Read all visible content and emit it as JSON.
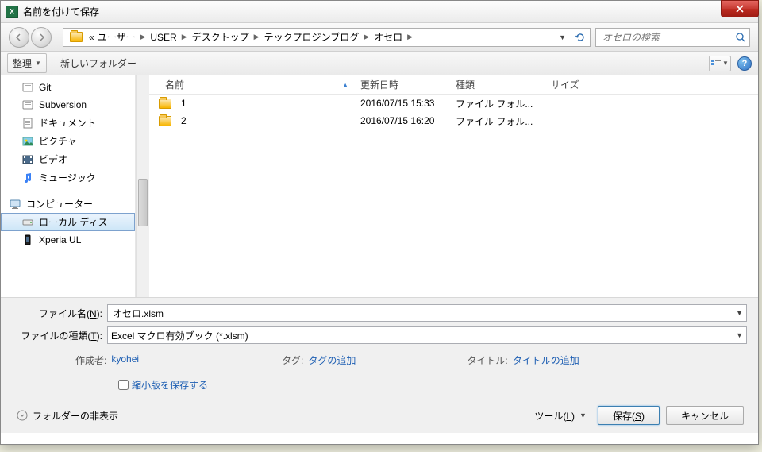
{
  "title": "名前を付けて保存",
  "breadcrumb": {
    "prefix": "«",
    "items": [
      "ユーザー",
      "USER",
      "デスクトップ",
      "テックプロジンブログ",
      "オセロ"
    ]
  },
  "search": {
    "placeholder": "オセロの検索"
  },
  "toolbar": {
    "organize": "整理",
    "newfolder": "新しいフォルダー"
  },
  "sidebar": {
    "items": [
      {
        "label": "Git"
      },
      {
        "label": "Subversion"
      },
      {
        "label": "ドキュメント"
      },
      {
        "label": "ピクチャ"
      },
      {
        "label": "ビデオ"
      },
      {
        "label": "ミュージック"
      }
    ],
    "computer": "コンピューター",
    "localdisk": "ローカル ディス",
    "xperia": "Xperia UL"
  },
  "columns": {
    "name": "名前",
    "date": "更新日時",
    "type": "種類",
    "size": "サイズ"
  },
  "files": [
    {
      "name": "1",
      "date": "2016/07/15 15:33",
      "type": "ファイル フォル..."
    },
    {
      "name": "2",
      "date": "2016/07/15 16:20",
      "type": "ファイル フォル..."
    }
  ],
  "fields": {
    "filename_label": "ファイル名(N):",
    "filename_value": "オセロ.xlsm",
    "filetype_label": "ファイルの種類(T):",
    "filetype_value": "Excel マクロ有効ブック (*.xlsm)"
  },
  "meta": {
    "author_label": "作成者:",
    "author_value": "kyohei",
    "tag_label": "タグ:",
    "tag_value": "タグの追加",
    "title_label": "タイトル:",
    "title_value": "タイトルの追加"
  },
  "thumbnail_check": "縮小版を保存する",
  "hide_folders": "フォルダーの非表示",
  "tools": "ツール(L)",
  "save": "保存(S)",
  "cancel": "キャンセル"
}
